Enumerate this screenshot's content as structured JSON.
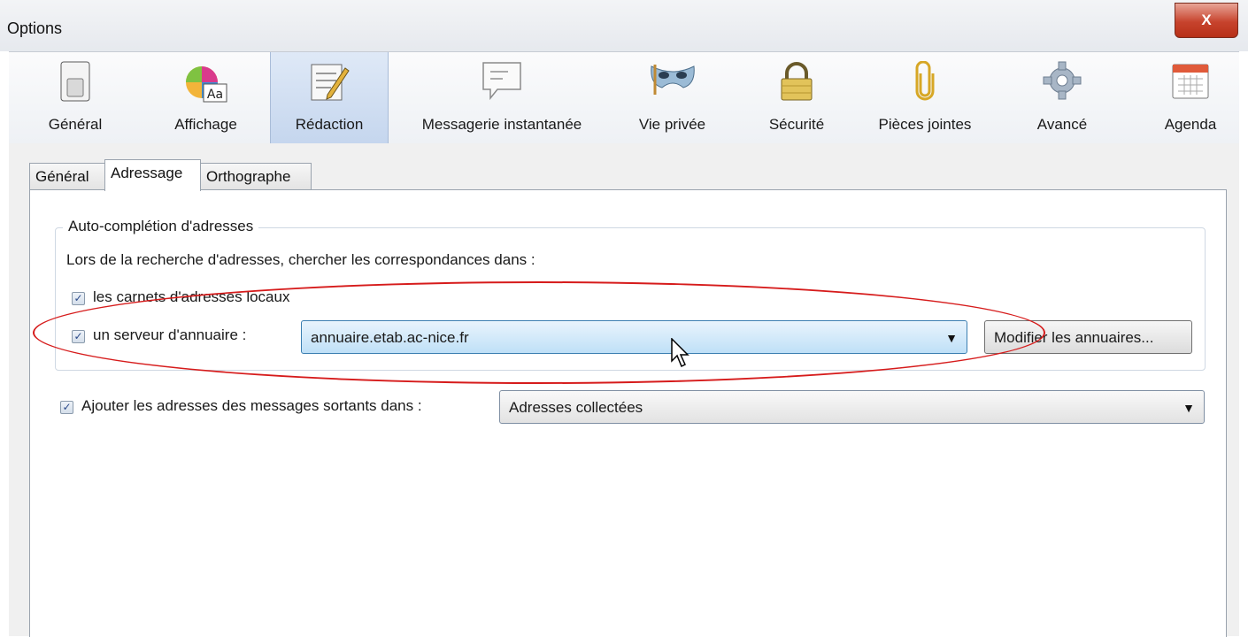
{
  "window": {
    "title": "Options",
    "close_label": "X"
  },
  "toolbar": {
    "panes": [
      {
        "label": "Général",
        "icon": "general-switch-icon"
      },
      {
        "label": "Affichage",
        "icon": "display-aa-icon"
      },
      {
        "label": "Rédaction",
        "icon": "composition-pencil-icon",
        "selected": true
      },
      {
        "label": "Messagerie instantanée",
        "icon": "chat-bubble-icon"
      },
      {
        "label": "Vie privée",
        "icon": "privacy-mask-icon"
      },
      {
        "label": "Sécurité",
        "icon": "security-lock-icon"
      },
      {
        "label": "Pièces jointes",
        "icon": "attachment-paperclip-icon"
      },
      {
        "label": "Avancé",
        "icon": "advanced-gear-icon"
      },
      {
        "label": "Agenda",
        "icon": "calendar-icon"
      }
    ]
  },
  "subtabs": [
    {
      "label": "Général"
    },
    {
      "label": "Adressage",
      "selected": true
    },
    {
      "label": "Orthographe"
    }
  ],
  "autocomplete": {
    "legend": "Auto-complétion d'adresses",
    "description": "Lors de la recherche d'adresses, chercher les correspondances dans :",
    "local_books": {
      "label": "les carnets d'adresses locaux",
      "checked": true
    },
    "directory_server": {
      "label": "un serveur d'annuaire :",
      "checked": true,
      "selected_value": "annuaire.etab.ac-nice.fr"
    },
    "edit_directories_button": "Modifier les annuaires..."
  },
  "outgoing": {
    "label": "Ajouter les adresses des messages sortants dans :",
    "checked": true,
    "selected_value": "Adresses collectées"
  },
  "colors": {
    "annotation": "#d61b1b",
    "selected_pane": "#c5d6ee",
    "active_combo": "#bfe0f7"
  }
}
